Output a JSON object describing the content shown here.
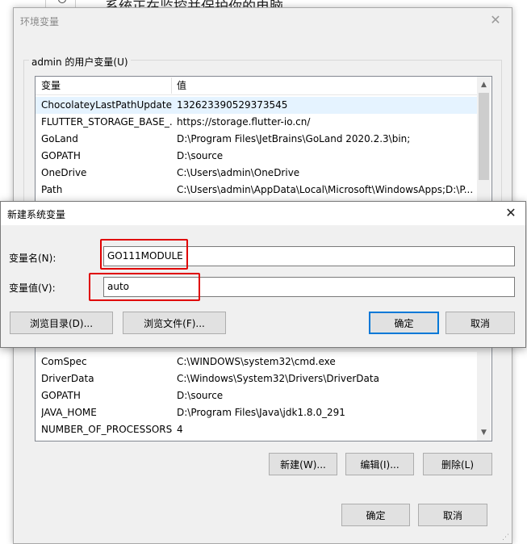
{
  "background": {
    "partial_text": "系统正在监控并保护你的电脑。"
  },
  "env_dialog": {
    "title": "环境变量",
    "user_vars_group_label": "admin 的用户变量(U)",
    "user_vars": {
      "headers": [
        "变量",
        "值"
      ],
      "rows": [
        {
          "name": "ChocolateyLastPathUpdate",
          "value": "132623390529373545"
        },
        {
          "name": "FLUTTER_STORAGE_BASE_...",
          "value": "https://storage.flutter-io.cn/"
        },
        {
          "name": "GoLand",
          "value": "D:\\Program Files\\JetBrains\\GoLand 2020.2.3\\bin;"
        },
        {
          "name": "GOPATH",
          "value": "D:\\source"
        },
        {
          "name": "OneDrive",
          "value": "C:\\Users\\admin\\OneDrive"
        },
        {
          "name": "Path",
          "value": "C:\\Users\\admin\\AppData\\Local\\Microsoft\\WindowsApps;D:\\P..."
        }
      ]
    },
    "system_vars": {
      "rows": [
        {
          "name": "ComSpec",
          "value": "C:\\WINDOWS\\system32\\cmd.exe"
        },
        {
          "name": "DriverData",
          "value": "C:\\Windows\\System32\\Drivers\\DriverData"
        },
        {
          "name": "GOPATH",
          "value": "D:\\source"
        },
        {
          "name": "JAVA_HOME",
          "value": "D:\\Program Files\\Java\\jdk1.8.0_291"
        },
        {
          "name": "NUMBER_OF_PROCESSORS",
          "value": "4"
        }
      ]
    },
    "system_buttons": {
      "new": "新建(W)...",
      "edit": "编辑(I)...",
      "delete": "删除(L)"
    },
    "ok": "确定",
    "cancel": "取消"
  },
  "new_var_dialog": {
    "title": "新建系统变量",
    "name_label": "变量名(N):",
    "value_label": "变量值(V):",
    "name_value": "GO111MODULE",
    "value_value": "auto",
    "browse_dir": "浏览目录(D)...",
    "browse_file": "浏览文件(F)...",
    "ok": "确定",
    "cancel": "取消"
  },
  "colors": {
    "highlight_red": "#e00000",
    "selected_row": "#e5f3ff",
    "default_button_border": "#0078d7"
  }
}
